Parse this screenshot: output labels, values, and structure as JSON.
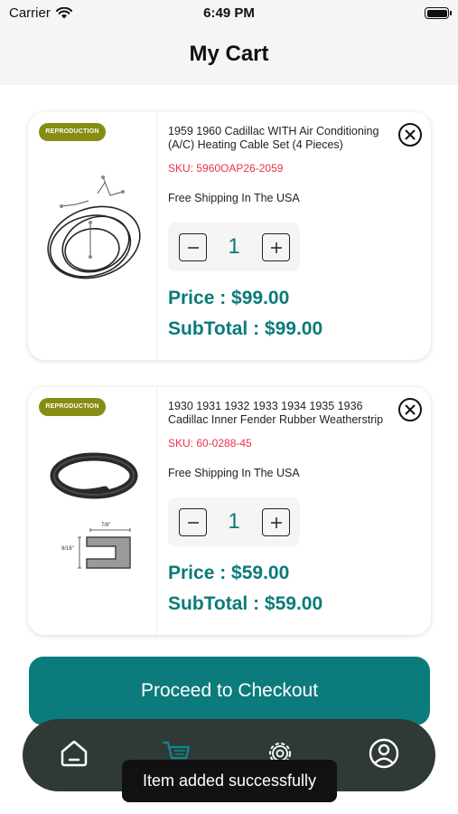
{
  "status_bar": {
    "carrier": "Carrier",
    "time": "6:49 PM"
  },
  "header": {
    "title": "My Cart"
  },
  "cart": {
    "items": [
      {
        "badge": "REPRODUCTION",
        "name": "1959 1960 Cadillac WITH Air Conditioning (A/C) Heating Cable Set (4 Pieces)",
        "sku": "SKU: 5960OAP26-2059",
        "shipping": "Free Shipping In The USA",
        "quantity": "1",
        "price": "Price : $99.00",
        "subtotal": "SubTotal : $99.00"
      },
      {
        "badge": "REPRODUCTION",
        "name": "1930 1931 1932 1933 1934 1935 1936 Cadillac Inner Fender Rubber Weatherstrip",
        "sku": "SKU: 60-0288-45",
        "shipping": "Free Shipping In The USA",
        "quantity": "1",
        "price": "Price : $59.00",
        "subtotal": "SubTotal : $59.00",
        "diagram": {
          "width_label": "7/8\"",
          "height_label": "9/16\""
        }
      }
    ]
  },
  "checkout": {
    "label": "Proceed to Checkout"
  },
  "tabs": [
    {
      "icon": "home-icon"
    },
    {
      "icon": "cart-icon",
      "active": true
    },
    {
      "icon": "settings-gear-icon"
    },
    {
      "icon": "profile-icon"
    }
  ],
  "toast": {
    "message": "Item added successfully"
  },
  "colors": {
    "accent": "#0b7b7b",
    "badge": "#868d12",
    "sku": "#e8334a",
    "tabbar": "#2f3a36"
  }
}
